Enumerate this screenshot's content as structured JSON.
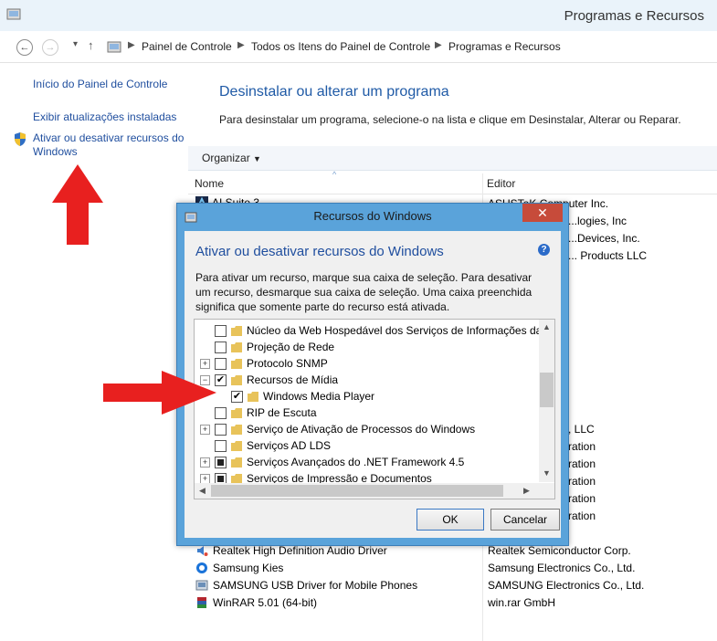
{
  "window": {
    "title": "Programas e Recursos"
  },
  "address": {
    "crumbs": [
      "Painel de Controle",
      "Todos os Itens do Painel de Controle",
      "Programas e Recursos"
    ]
  },
  "nav": {
    "home": "Início do Painel de Controle",
    "updates": "Exibir atualizações instaladas",
    "features_line1": "Ativar ou desativar recursos do",
    "features_line2": "Windows"
  },
  "main": {
    "heading": "Desinstalar ou alterar um programa",
    "subheading": "Para desinstalar um programa, selecione-o na lista e clique em Desinstalar, Alterar ou Reparar.",
    "organize": "Organizar",
    "col_name": "Nome",
    "col_publisher": "Editor"
  },
  "programs_top": [
    {
      "name": "AI Suite 3",
      "publisher": "ASUSTeK Computer Inc."
    },
    {
      "name": "",
      "publisher": "...logies, Inc"
    },
    {
      "name": "",
      "publisher": "...Devices, Inc."
    },
    {
      "name": "",
      "publisher": "... Products LLC"
    }
  ],
  "publishers_partial": [
    ", LLC",
    "ration",
    "ration",
    "ration",
    "ration",
    "ration"
  ],
  "programs_bottom": [
    {
      "name": "Realtek High Definition Audio Driver",
      "publisher": "Realtek Semiconductor Corp."
    },
    {
      "name": "Samsung Kies",
      "publisher": "Samsung Electronics Co., Ltd."
    },
    {
      "name": "SAMSUNG USB Driver for Mobile Phones",
      "publisher": "SAMSUNG Electronics Co., Ltd."
    },
    {
      "name": "WinRAR 5.01 (64-bit)",
      "publisher": "win.rar GmbH"
    }
  ],
  "dialog": {
    "title": "Recursos do Windows",
    "close": "✕",
    "heading": "Ativar ou desativar recursos do Windows",
    "description": "Para ativar um recurso, marque sua caixa de seleção. Para desativar um recurso, desmarque sua caixa de seleção. Uma caixa preenchida significa que somente parte do recurso está ativada.",
    "ok": "OK",
    "cancel": "Cancelar",
    "features": [
      {
        "label": "Núcleo da Web Hospedável dos Serviços de Informações da",
        "state": "unchecked",
        "expander": "",
        "indent": 0
      },
      {
        "label": "Projeção de Rede",
        "state": "unchecked",
        "expander": "",
        "indent": 0
      },
      {
        "label": "Protocolo SNMP",
        "state": "unchecked",
        "expander": "+",
        "indent": 0
      },
      {
        "label": "Recursos de Mídia",
        "state": "checked",
        "expander": "−",
        "indent": 0
      },
      {
        "label": "Windows Media Player",
        "state": "checked",
        "expander": "",
        "indent": 1
      },
      {
        "label": "RIP de Escuta",
        "state": "unchecked",
        "expander": "",
        "indent": 0
      },
      {
        "label": "Serviço de Ativação de Processos do Windows",
        "state": "unchecked",
        "expander": "+",
        "indent": 0
      },
      {
        "label": "Serviços AD LDS",
        "state": "unchecked",
        "expander": "",
        "indent": 0
      },
      {
        "label": "Serviços Avançados do .NET Framework 4.5",
        "state": "partial",
        "expander": "+",
        "indent": 0
      },
      {
        "label": "Serviços de Impressão e Documentos",
        "state": "partial",
        "expander": "+",
        "indent": 0
      }
    ]
  },
  "colors": {
    "accent_red": "#e8201f",
    "link_blue": "#1f4e9e",
    "dialog_frame": "#5aa3da"
  }
}
